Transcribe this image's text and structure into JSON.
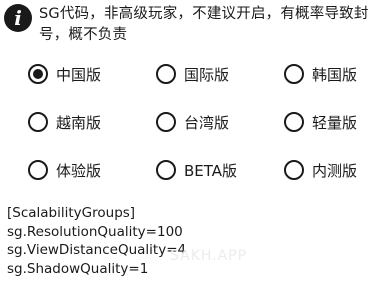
{
  "notice": {
    "icon": "info-icon",
    "text": "SG代码，非高级玩家，不建议开启，有概率导致封号，概不负责"
  },
  "versions": [
    {
      "label": "中国版",
      "checked": true
    },
    {
      "label": "国际版",
      "checked": false
    },
    {
      "label": "韩国版",
      "checked": false
    },
    {
      "label": "越南版",
      "checked": false
    },
    {
      "label": "台湾版",
      "checked": false
    },
    {
      "label": "轻量版",
      "checked": false
    },
    {
      "label": "体验版",
      "checked": false
    },
    {
      "label": "BETA版",
      "checked": false
    },
    {
      "label": "内测版",
      "checked": false
    }
  ],
  "config_lines": [
    "[ScalabilityGroups]",
    "sg.ResolutionQuality=100",
    "sg.ViewDistanceQuality=4",
    "sg.ShadowQuality=1"
  ],
  "watermark": "SAKH.APP"
}
